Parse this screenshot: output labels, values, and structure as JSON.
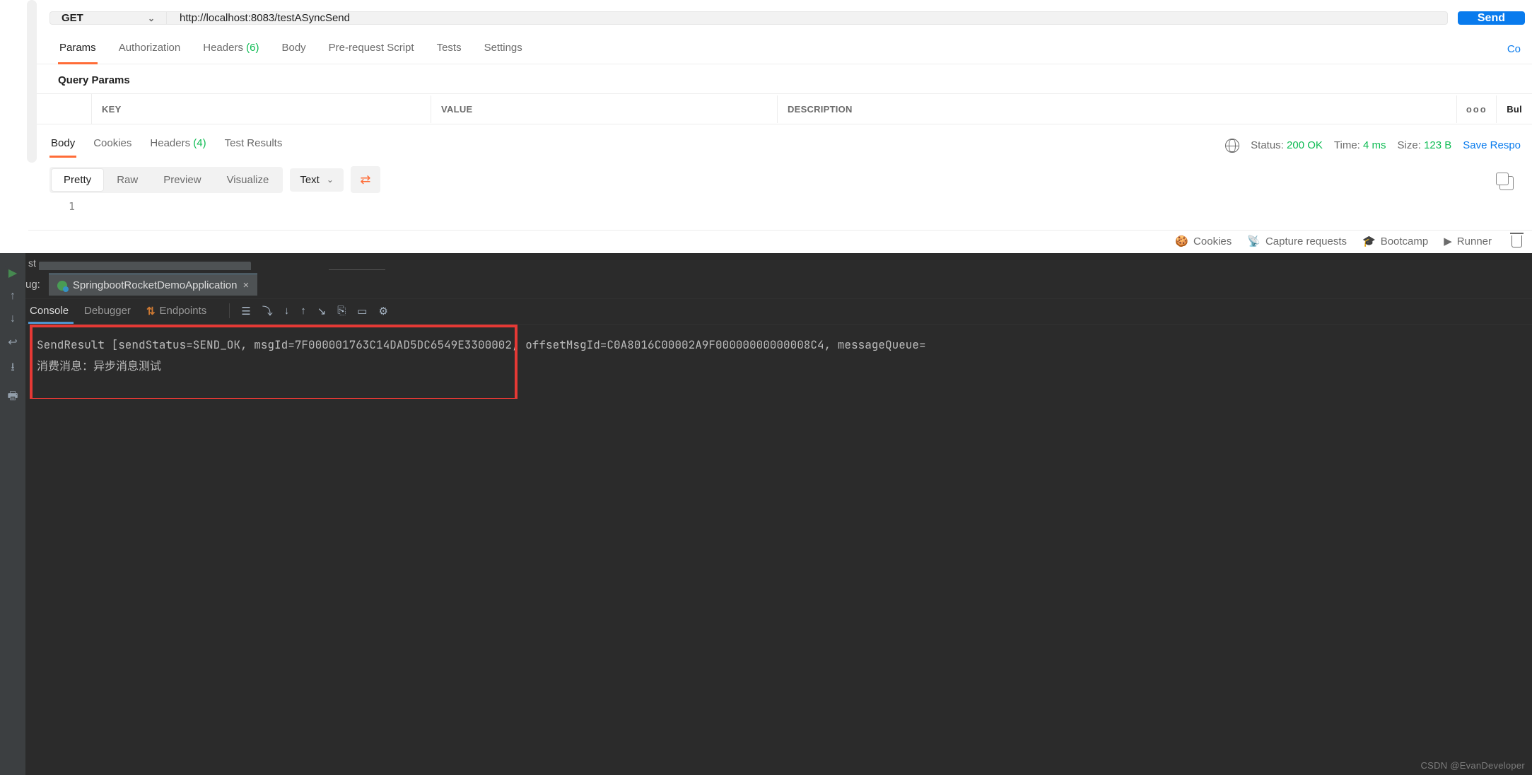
{
  "request": {
    "method": "GET",
    "url": "http://localhost:8083/testASyncSend",
    "send_label": "Send"
  },
  "request_tabs": {
    "items": [
      "Params",
      "Authorization",
      "Headers",
      "Body",
      "Pre-request Script",
      "Tests",
      "Settings"
    ],
    "headers_count": "(6)",
    "right_link": "Co"
  },
  "query": {
    "title": "Query Params",
    "columns": {
      "key": "KEY",
      "value": "VALUE",
      "desc": "DESCRIPTION"
    },
    "more": "ooo",
    "bulk": "Bul"
  },
  "response_tabs": {
    "items": [
      "Body",
      "Cookies",
      "Headers",
      "Test Results"
    ],
    "headers_count": "(4)"
  },
  "response_meta": {
    "status_label": "Status:",
    "status_value": "200 OK",
    "time_label": "Time:",
    "time_value": "4 ms",
    "size_label": "Size:",
    "size_value": "123 B",
    "save": "Save Respo"
  },
  "viewer": {
    "pretty": "Pretty",
    "raw": "Raw",
    "preview": "Preview",
    "visualize": "Visualize",
    "content_type": "Text"
  },
  "code": {
    "ln": "1",
    "body": ""
  },
  "statusbar": {
    "cookies": "Cookies",
    "capture": "Capture requests",
    "bootcamp": "Bootcamp",
    "runner": "Runner"
  },
  "ide": {
    "top_left_label": "st",
    "run_prefix": "ug:",
    "run_tab": "SpringbootRocketDemoApplication",
    "tabs": {
      "console": "Console",
      "debugger": "Debugger",
      "endpoints": "Endpoints"
    },
    "log_line1": "SendResult [sendStatus=SEND_OK, msgId=7F000001763C14DAD5DC6549E3300002, offsetMsgId=C0A8016C00002A9F00000000000008C4, messageQueue=",
    "log_line2": "消费消息：异步消息测试",
    "watermark": "CSDN @EvanDeveloper"
  }
}
